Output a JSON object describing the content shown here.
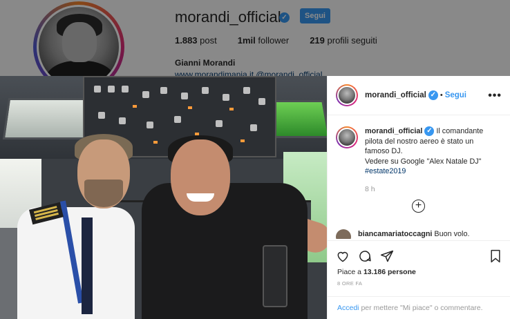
{
  "profile": {
    "username": "morandi_official",
    "follow_label": "Segui",
    "stats": {
      "posts_value": "1.883",
      "posts_label": "post",
      "followers_value": "1mil",
      "followers_label": "follower",
      "following_value": "219",
      "following_label": "profili seguiti"
    },
    "full_name": "Gianni Morandi",
    "website": "www.morandimania.it @morandi_official"
  },
  "post": {
    "header": {
      "username": "morandi_official",
      "separator": "•",
      "follow_label": "Segui",
      "more_icon": "more-horizontal-icon"
    },
    "caption": {
      "username": "morandi_official",
      "text": "Il comandante pilota del nostro aereo è stato un famoso DJ.",
      "line2": "Vedere su Google \"Alex Natale DJ\"",
      "hashtag": "#estate2019",
      "time": "8 h"
    },
    "load_more_icon": "plus-circle-icon",
    "comment": {
      "username": "biancamariatoccagni",
      "text": "Buon volo."
    },
    "likes_prefix": "Piace a",
    "likes_count": "13.186",
    "likes_suffix": "persone",
    "posted_time": "8 ORE FA",
    "login_link": "Accedi",
    "login_text": "per mettere \"Mi piace\" o commentare."
  },
  "colors": {
    "accent": "#3897f0",
    "text": "#262626",
    "muted": "#999999",
    "hashtag": "#003569"
  }
}
